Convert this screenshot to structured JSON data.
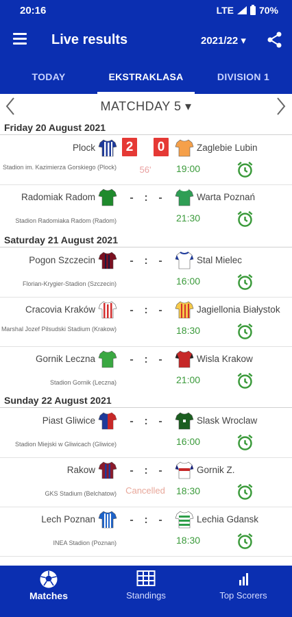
{
  "status": {
    "time": "20:16",
    "network": "LTE",
    "battery": "70%"
  },
  "app": {
    "title": "Live results",
    "season": "2021/22 ▾"
  },
  "tabs": [
    {
      "label": "TODAY",
      "active": false
    },
    {
      "label": "EKSTRAKLASA",
      "active": true
    },
    {
      "label": "DIVISION 1",
      "active": false
    }
  ],
  "matchday": {
    "label": "MATCHDAY 5 ▾"
  },
  "days": [
    {
      "label": "Friday 20 August 2021"
    },
    {
      "label": "Saturday 21 August 2021"
    },
    {
      "label": "Sunday 22 August 2021"
    }
  ],
  "matches": [
    {
      "home": "Plock",
      "away": "Zaglebie Lubin",
      "home_score": "2",
      "away_score": "0",
      "stadium": "Stadion im. Kazimierza Gorskiego (Plock)",
      "minute": "56'",
      "time": "19:00",
      "home_icon": "shirt-blue-white-stripes",
      "away_icon": "shirt-orange"
    },
    {
      "home": "Radomiak Radom",
      "away": "Warta Poznań",
      "home_score": "-",
      "away_score": "-",
      "stadium": "Stadion Radomiaka Radom (Radom)",
      "minute": "",
      "time": "21:30",
      "home_icon": "shirt-green",
      "away_icon": "shirt-green-white"
    },
    {
      "home": "Pogon Szczecin",
      "away": "Stal Mielec",
      "home_score": "-",
      "away_score": "-",
      "stadium": "Florian-Krygier-Stadion (Szczecin)",
      "minute": "",
      "time": "16:00",
      "home_icon": "shirt-maroon-navy-stripes",
      "away_icon": "shirt-white-blue"
    },
    {
      "home": "Cracovia Kraków",
      "away": "Jagiellonia Białystok",
      "home_score": "-",
      "away_score": "-",
      "stadium": "Marshal Jozef Pilsudski Stadium (Krakow)",
      "minute": "",
      "time": "18:30",
      "home_icon": "shirt-red-white-stripes",
      "away_icon": "shirt-yellow-red-stripes"
    },
    {
      "home": "Gornik Leczna",
      "away": "Wisla Krakow",
      "home_score": "-",
      "away_score": "-",
      "stadium": "Stadion Gornik (Leczna)",
      "minute": "",
      "time": "21:00",
      "home_icon": "shirt-green",
      "away_icon": "shirt-red-black"
    },
    {
      "home": "Piast Gliwice",
      "away": "Slask Wroclaw",
      "home_score": "-",
      "away_score": "-",
      "stadium": "Stadion Miejski w Gliwicach (Gliwice)",
      "minute": "",
      "time": "16:00",
      "home_icon": "shirt-red-blue-halves",
      "away_icon": "shirt-dark-green"
    },
    {
      "home": "Rakow",
      "away": "Gornik Z.",
      "home_score": "-",
      "away_score": "-",
      "stadium": "GKS Stadium (Belchatow)",
      "minute": "Cancelled",
      "time": "18:30",
      "home_icon": "shirt-red-blue-stripes",
      "away_icon": "shirt-white-red-band"
    },
    {
      "home": "Lech Poznan",
      "away": "Lechia Gdansk",
      "home_score": "-",
      "away_score": "-",
      "stadium": "INEA Stadion (Poznan)",
      "minute": "",
      "time": "18:30",
      "home_icon": "shirt-blue-white-stripes",
      "away_icon": "shirt-green-white-hoops"
    }
  ],
  "bottom_nav": [
    {
      "label": "Matches",
      "icon": "soccer-ball-icon",
      "active": true
    },
    {
      "label": "Standings",
      "icon": "table-icon",
      "active": false
    },
    {
      "label": "Top Scorers",
      "icon": "bar-chart-icon",
      "active": false
    }
  ],
  "colors": {
    "primary": "#0b2fb1",
    "score_live": "#e53935",
    "kickoff_time": "#3a9a3a",
    "alarm": "#3a9a3a"
  }
}
